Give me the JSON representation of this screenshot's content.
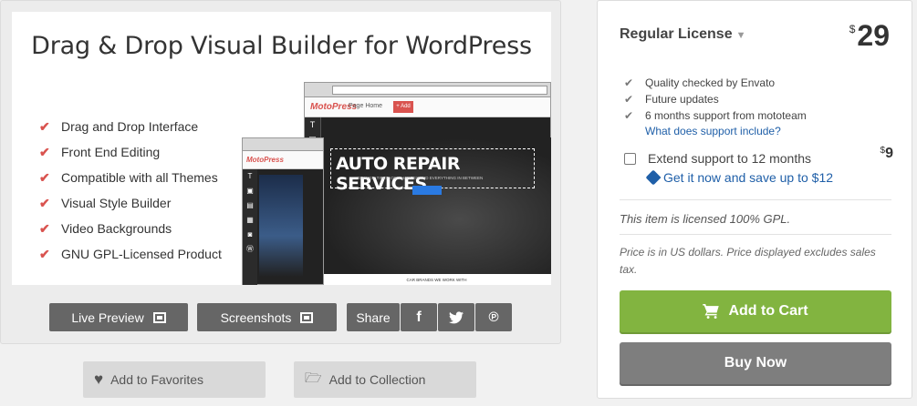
{
  "banner": {
    "title": "Drag & Drop Visual Builder for WordPress",
    "features": [
      "Drag and Drop Interface",
      "Front End Editing",
      "Compatible with all Themes",
      "Visual Style Builder",
      "Video Backgrounds",
      "GNU GPL-Licensed Product"
    ],
    "mockup": {
      "logo": "MotoPress",
      "page_label": "Page",
      "page_value": "Home",
      "add_label": "+ Add",
      "hero_title": "AUTO REPAIR SERVICES",
      "hero_sub": "BRAKES, TIRES, OIL CHANGES AND EVERYTHING IN BETWEEN",
      "bottom_text": "CAR BRANDS WE WORK WITH"
    }
  },
  "actions": {
    "live_preview": "Live Preview",
    "screenshots": "Screenshots",
    "share": "Share",
    "add_favorites": "Add to Favorites",
    "add_collection": "Add to Collection"
  },
  "license": {
    "title": "Regular License",
    "currency": "$",
    "price": "29",
    "features": [
      "Quality checked by Envato",
      "Future updates",
      "6 months support from mototeam"
    ],
    "support_link": "What does support include?",
    "extend_label": "Extend support to 12 months",
    "extend_price": "9",
    "save_text": "Get it now and save up to $12",
    "gpl_note": "This item is licensed 100% GPL.",
    "price_note": "Price is in US dollars. Price displayed excludes sales tax.",
    "add_to_cart": "Add to Cart",
    "buy_now": "Buy Now"
  },
  "colors": {
    "accent_red": "#d9534f",
    "cart_green": "#82b440",
    "link_blue": "#1f5fa8"
  }
}
